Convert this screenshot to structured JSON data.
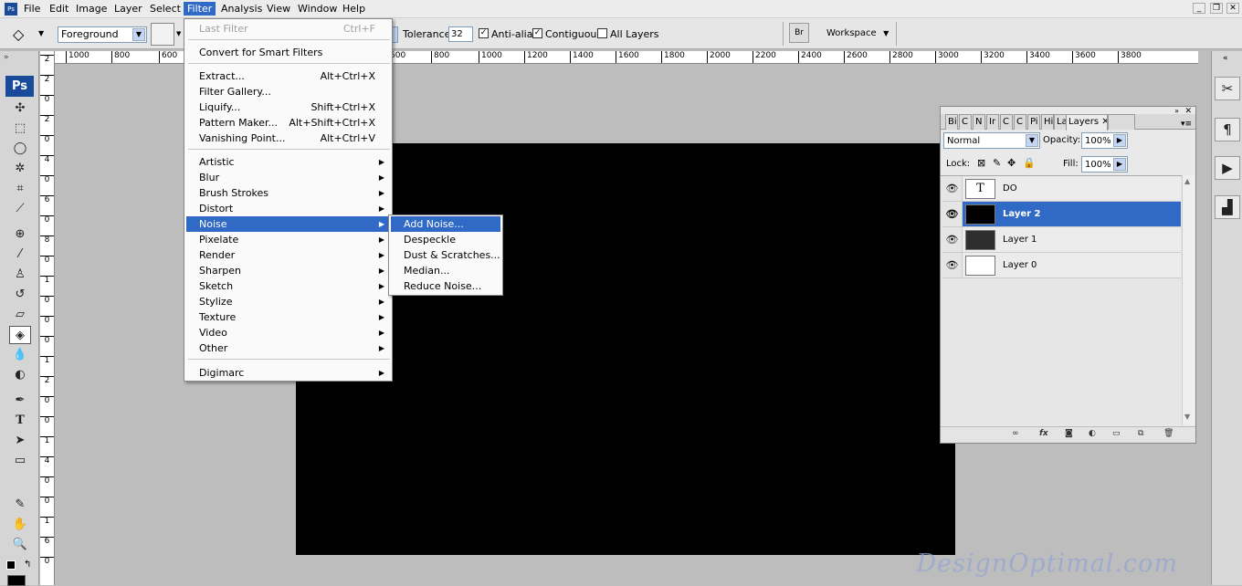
{
  "menubar": {
    "items": [
      "File",
      "Edit",
      "Image",
      "Layer",
      "Select",
      "Filter",
      "Analysis",
      "View",
      "Window",
      "Help"
    ],
    "active": "Filter"
  },
  "options": {
    "fill_source": "Foreground",
    "tolerance_label": "Tolerance:",
    "tolerance_value": "32",
    "antialias_label": "Anti-alias",
    "antialias_checked": true,
    "contiguous_label": "Contiguous",
    "contiguous_checked": true,
    "all_layers_label": "All Layers",
    "all_layers_checked": false,
    "workspace_label": "Workspace"
  },
  "ruler": {
    "h_ticks": [
      "1000",
      "800",
      "600",
      "600",
      "800",
      "1000",
      "1200",
      "1400",
      "1600",
      "1800",
      "2000",
      "2200",
      "2400",
      "2600",
      "2800",
      "3000",
      "3200",
      "3400",
      "3600",
      "3800"
    ],
    "v_ticks": [
      "2",
      "2",
      "0",
      "2",
      "0",
      "4",
      "0",
      "6",
      "0",
      "8",
      "0",
      "1",
      "0",
      "0",
      "0",
      "1",
      "2",
      "0",
      "0",
      "1",
      "4",
      "0",
      "0",
      "1",
      "6",
      "0"
    ]
  },
  "filter_menu": {
    "last_filter": "Last Filter",
    "last_filter_shortcut": "Ctrl+F",
    "convert": "Convert for Smart Filters",
    "group1": [
      {
        "label": "Extract...",
        "shortcut": "Alt+Ctrl+X"
      },
      {
        "label": "Filter Gallery...",
        "shortcut": ""
      },
      {
        "label": "Liquify...",
        "shortcut": "Shift+Ctrl+X"
      },
      {
        "label": "Pattern Maker...",
        "shortcut": "Alt+Shift+Ctrl+X"
      },
      {
        "label": "Vanishing Point...",
        "shortcut": "Alt+Ctrl+V"
      }
    ],
    "group2": [
      "Artistic",
      "Blur",
      "Brush Strokes",
      "Distort",
      "Noise",
      "Pixelate",
      "Render",
      "Sharpen",
      "Sketch",
      "Stylize",
      "Texture",
      "Video",
      "Other"
    ],
    "selected": "Noise",
    "digimarc": "Digimarc"
  },
  "noise_menu": {
    "items": [
      "Add Noise...",
      "Despeckle",
      "Dust & Scratches...",
      "Median...",
      "Reduce Noise..."
    ],
    "selected": "Add Noise..."
  },
  "layers_panel": {
    "tabs": [
      "Bi",
      "C",
      "N",
      "Ir",
      "C",
      "C",
      "Pi",
      "Hi",
      "La"
    ],
    "active_tab": "Layers",
    "blend_mode": "Normal",
    "opacity_label": "Opacity:",
    "opacity": "100%",
    "lock_label": "Lock:",
    "fill_label": "Fill:",
    "fill": "100%",
    "layers": [
      {
        "name": "DO",
        "thumb": "T",
        "selected": false,
        "thumb_color": "#ffffff"
      },
      {
        "name": "Layer 2",
        "thumb": "",
        "selected": true,
        "thumb_color": "#000000"
      },
      {
        "name": "Layer 1",
        "thumb": "",
        "selected": false,
        "thumb_color": "#2e2e2e"
      },
      {
        "name": "Layer 0",
        "thumb": "",
        "selected": false,
        "thumb_color": "#ffffff"
      }
    ]
  },
  "toolbox": {
    "logo": "Ps"
  },
  "watermark": "DesignOptimal.com",
  "colors": {
    "accent": "#3169c6",
    "canvas": "#000000"
  }
}
